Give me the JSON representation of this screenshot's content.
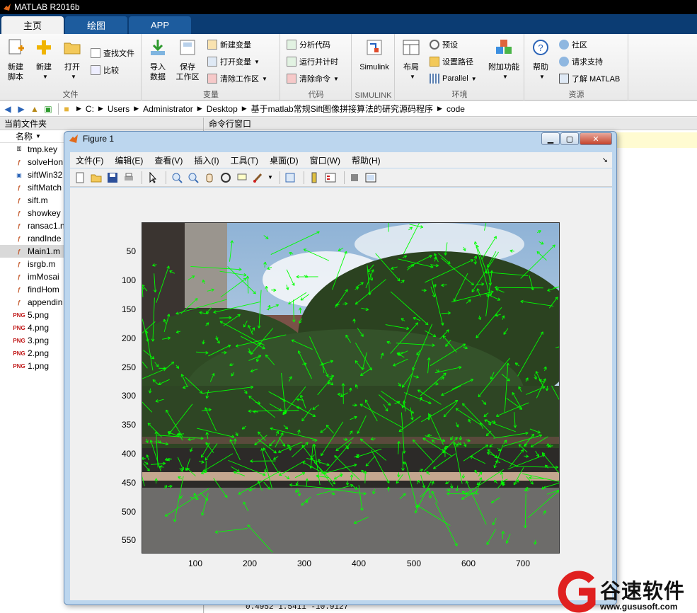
{
  "app": {
    "title": "MATLAB R2016b"
  },
  "tabs": [
    {
      "label": "主页"
    },
    {
      "label": "绘图"
    },
    {
      "label": "APP"
    }
  ],
  "ribbon": {
    "file": {
      "label": "文件",
      "new_script": "新建\n脚本",
      "new": "新建",
      "open": "打开",
      "find_files": "查找文件",
      "compare": "比较"
    },
    "variable": {
      "label": "变量",
      "import": "导入\n数据",
      "save_ws": "保存\n工作区",
      "new_var": "新建变量",
      "open_var": "打开变量",
      "clear_ws": "清除工作区"
    },
    "code": {
      "label": "代码",
      "analyze": "分析代码",
      "run_time": "运行并计时",
      "clear_cmd": "清除命令"
    },
    "simulink": {
      "label": "SIMULINK",
      "simulink": "Simulink"
    },
    "env": {
      "label": "环境",
      "layout": "布局",
      "prefs": "预设",
      "set_path": "设置路径",
      "parallel": "Parallel",
      "addons": "附加功能"
    },
    "resources": {
      "label": "资源",
      "help": "帮助",
      "community": "社区",
      "support": "请求支持",
      "learn": "了解 MATLAB"
    }
  },
  "address": {
    "crumbs": [
      "C:",
      "Users",
      "Administrator",
      "Desktop",
      "基于matlab常规Sift图像拼接算法的研究源码程序",
      "code"
    ]
  },
  "current_folder": {
    "title": "当前文件夹",
    "name_col": "名称",
    "files": [
      {
        "name": "tmp.key",
        "icon": "key-file-icon"
      },
      {
        "name": "solveHon",
        "icon": "m-file-icon"
      },
      {
        "name": "siftWin32",
        "icon": "exe-file-icon"
      },
      {
        "name": "siftMatch",
        "icon": "m-file-icon"
      },
      {
        "name": "sift.m",
        "icon": "m-file-icon"
      },
      {
        "name": "showkey",
        "icon": "m-file-icon"
      },
      {
        "name": "ransac1.n",
        "icon": "m-file-icon"
      },
      {
        "name": "randInde",
        "icon": "m-file-icon"
      },
      {
        "name": "Main1.m",
        "icon": "m-file-icon"
      },
      {
        "name": "isrgb.m",
        "icon": "m-file-icon"
      },
      {
        "name": "imMosai",
        "icon": "m-file-icon"
      },
      {
        "name": "findHom",
        "icon": "m-file-icon"
      },
      {
        "name": "appendin",
        "icon": "m-file-icon"
      },
      {
        "name": "5.png",
        "icon": "png-file-icon"
      },
      {
        "name": "4.png",
        "icon": "png-file-icon"
      },
      {
        "name": "3.png",
        "icon": "png-file-icon"
      },
      {
        "name": "2.png",
        "icon": "png-file-icon"
      },
      {
        "name": "1.png",
        "icon": "png-file-icon"
      }
    ]
  },
  "command_window": {
    "title": "命令行窗口",
    "output_line": "0.4952     1.5411   -10.9127"
  },
  "figure": {
    "title": "Figure 1",
    "menu": [
      "文件(F)",
      "编辑(E)",
      "查看(V)",
      "插入(I)",
      "工具(T)",
      "桌面(D)",
      "窗口(W)",
      "帮助(H)"
    ],
    "y_ticks": [
      "50",
      "100",
      "150",
      "200",
      "250",
      "300",
      "350",
      "400",
      "450",
      "500",
      "550"
    ],
    "x_ticks": [
      "100",
      "200",
      "300",
      "400",
      "500",
      "600",
      "700"
    ],
    "keypoint_color": "#00ff00"
  },
  "watermark": {
    "text": "谷速软件",
    "url": "www.gususoft.com"
  }
}
